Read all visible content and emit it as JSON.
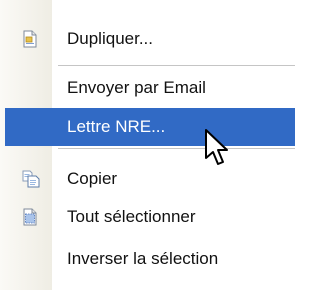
{
  "context_menu": {
    "items": [
      {
        "label": "Dupliquer...",
        "icon": "document-icon",
        "highlighted": false
      },
      {
        "label": "Envoyer par Email",
        "icon": null,
        "highlighted": false
      },
      {
        "label": "Lettre NRE...",
        "icon": null,
        "highlighted": true
      },
      {
        "label": "Copier",
        "icon": "copy-icon",
        "highlighted": false
      },
      {
        "label": "Tout sélectionner",
        "icon": "select-all-icon",
        "highlighted": false
      },
      {
        "label": "Inverser la sélection",
        "icon": null,
        "highlighted": false
      }
    ]
  },
  "colors": {
    "highlight": "#316ac5",
    "separator": "#c5c5c5",
    "gutter": "#efede4"
  }
}
